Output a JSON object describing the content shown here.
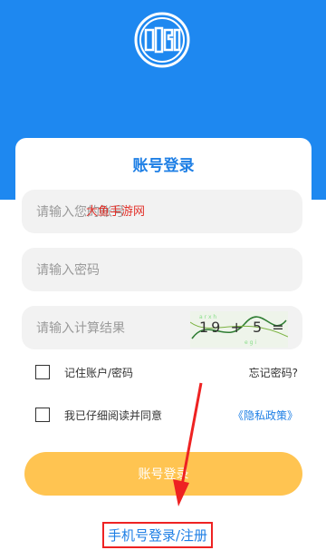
{
  "card": {
    "title": "账号登录"
  },
  "fields": {
    "account_placeholder": "请输入您的账号",
    "password_placeholder": "请输入密码",
    "captcha_placeholder": "请输入计算结果"
  },
  "captcha": {
    "text": "19 + 5 ="
  },
  "options": {
    "remember_label": "记住账户/密码",
    "forgot_label": "忘记密码?",
    "agree_label": "我已仔细阅读并同意",
    "privacy_label": "《隐私政策》"
  },
  "buttons": {
    "login_label": "账号登录",
    "phone_login_label": "手机号登录/注册"
  },
  "watermark": {
    "text": "大鱼手游网"
  },
  "colors": {
    "header_blue": "#1e88f0",
    "accent_blue": "#1e7fe5",
    "button_yellow": "#ffc451",
    "annotation_red": "#e22"
  }
}
